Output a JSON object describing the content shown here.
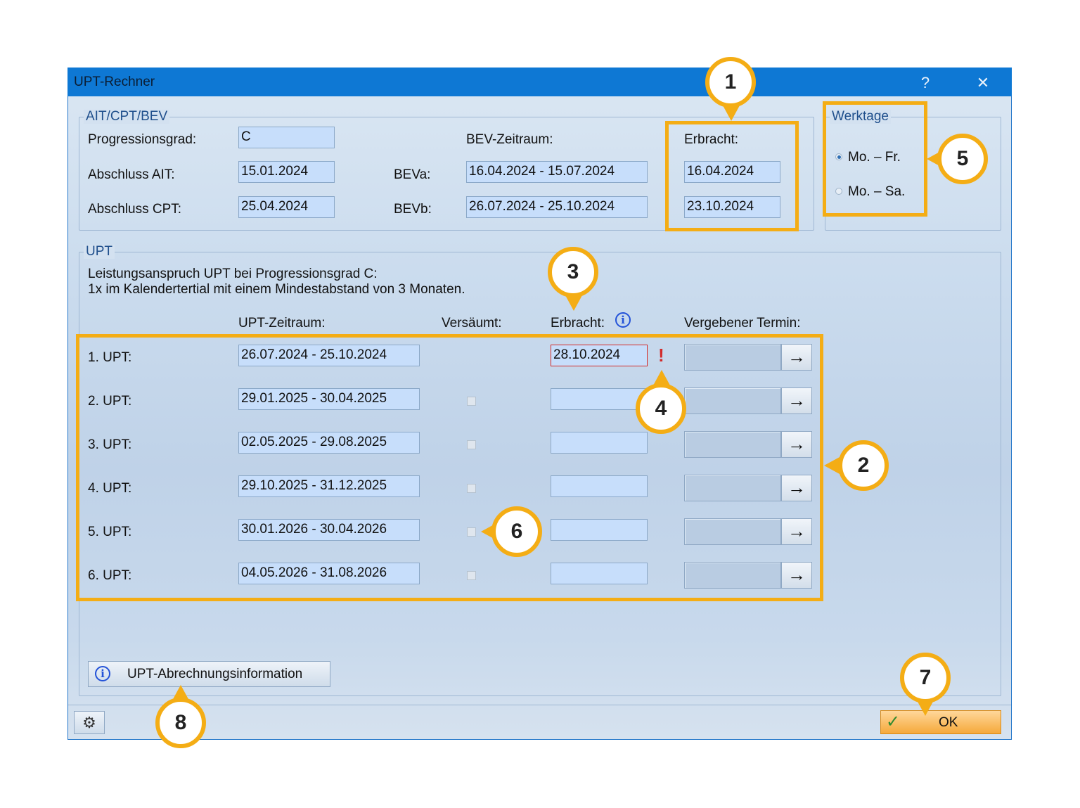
{
  "window": {
    "title": "UPT-Rechner",
    "help_symbol": "?",
    "close_symbol": "✕"
  },
  "ait_group": {
    "legend": "AIT/CPT/BEV",
    "progressionsgrad_label": "Progressionsgrad:",
    "progressionsgrad_value": "C",
    "abschluss_ait_label": "Abschluss AIT:",
    "abschluss_ait_value": "15.01.2024",
    "abschluss_cpt_label": "Abschluss CPT:",
    "abschluss_cpt_value": "25.04.2024",
    "bev_zeitraum_label": "BEV-Zeitraum:",
    "beva_label": "BEVa:",
    "beva_value": "16.04.2024 - 15.07.2024",
    "bevb_label": "BEVb:",
    "bevb_value": "26.07.2024 - 25.10.2024",
    "erbracht_label": "Erbracht:",
    "erbracht_a": "16.04.2024",
    "erbracht_b": "23.10.2024"
  },
  "werktage": {
    "legend": "Werktage",
    "option1": "Mo. – Fr.",
    "option2": "Mo. – Sa.",
    "selected": "Mo. – Fr."
  },
  "upt_group": {
    "legend": "UPT",
    "info_line1": "Leistungsanspruch UPT bei Progressionsgrad C:",
    "info_line2": "1x im Kalendertertial mit einem Mindestabstand von 3 Monaten.",
    "col_zeitraum": "UPT-Zeitraum:",
    "col_versaeumt": "Versäumt:",
    "col_erbracht": "Erbracht:",
    "col_termin": "Vergebener Termin:",
    "rows": [
      {
        "label": "1. UPT:",
        "zeitraum": "26.07.2024 - 25.10.2024",
        "erbracht": "28.10.2024",
        "warning": "!"
      },
      {
        "label": "2. UPT:",
        "zeitraum": "29.01.2025 - 30.04.2025",
        "erbracht": ""
      },
      {
        "label": "3. UPT:",
        "zeitraum": "02.05.2025 - 29.08.2025",
        "erbracht": ""
      },
      {
        "label": "4. UPT:",
        "zeitraum": "29.10.2025 - 31.12.2025",
        "erbracht": ""
      },
      {
        "label": "5. UPT:",
        "zeitraum": "30.01.2026 - 30.04.2026",
        "erbracht": ""
      },
      {
        "label": "6. UPT:",
        "zeitraum": "04.05.2026 - 31.08.2026",
        "erbracht": ""
      }
    ],
    "abrechnung_button": "UPT-Abrechnungsinformation"
  },
  "footer": {
    "ok_label": "OK",
    "ok_check": "✓",
    "arrow_symbol": "→",
    "gear_symbol": "⚙",
    "info_symbol": "i"
  },
  "callouts": [
    "1",
    "2",
    "3",
    "4",
    "5",
    "6",
    "7",
    "8"
  ],
  "colors": {
    "titlebar": "#0e78d4",
    "highlight": "#f4ad15",
    "field": "#c7defb",
    "warning": "#d22a2a",
    "info": "#2352d8"
  }
}
